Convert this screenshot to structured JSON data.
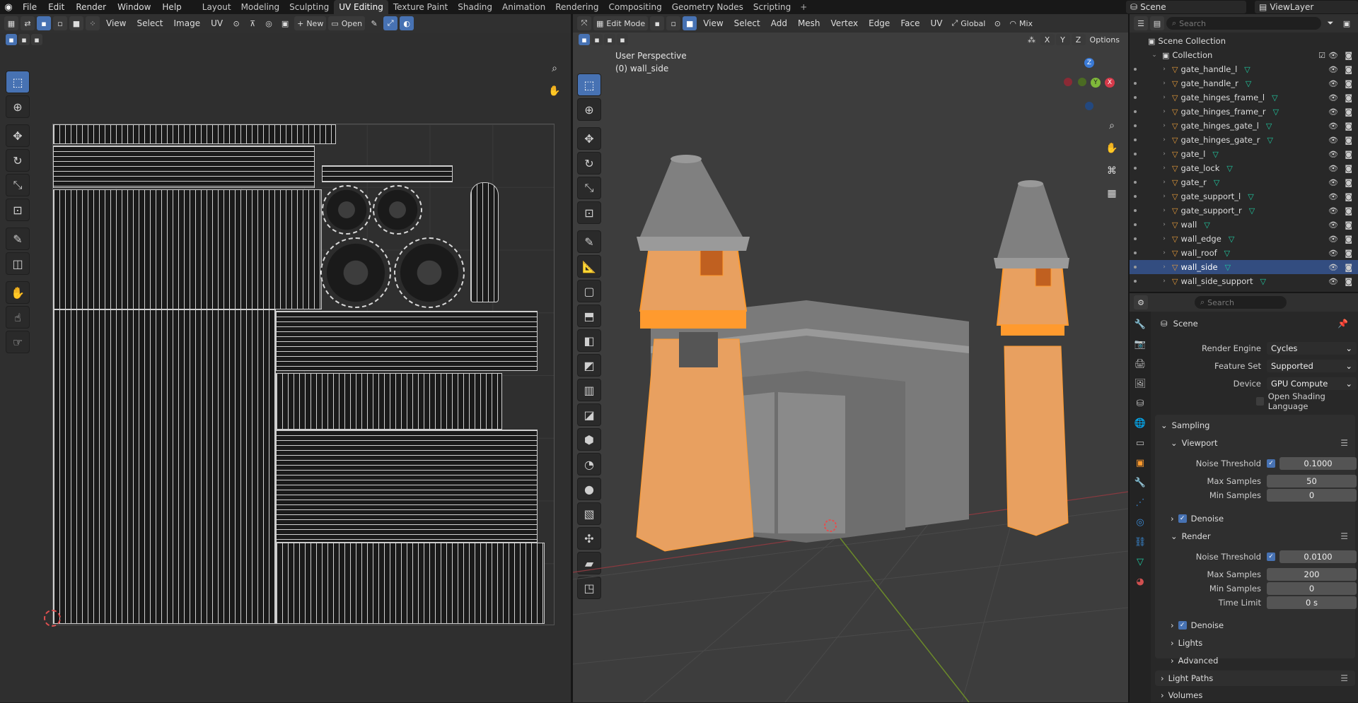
{
  "topbar": {
    "menus": [
      "File",
      "Edit",
      "Render",
      "Window",
      "Help"
    ],
    "workspaces": [
      "Layout",
      "Modeling",
      "Sculpting",
      "UV Editing",
      "Texture Paint",
      "Shading",
      "Animation",
      "Rendering",
      "Compositing",
      "Geometry Nodes",
      "Scripting"
    ],
    "active_workspace": "UV Editing",
    "scene": "Scene",
    "view_layer": "ViewLayer",
    "add_tab": "+"
  },
  "uv_editor": {
    "menus": [
      "View",
      "Select",
      "Image",
      "UV"
    ],
    "new_label": "New",
    "open_label": "Open",
    "new_icon": "+"
  },
  "viewport": {
    "mode": "Edit Mode",
    "menus": [
      "View",
      "Select",
      "Add",
      "Mesh",
      "Vertex",
      "Edge",
      "Face",
      "UV"
    ],
    "transform": "Global",
    "shading": "Mix",
    "options": "Options",
    "perspective": "User Perspective",
    "object_info": "(0) wall_side",
    "axes": {
      "x": "X",
      "y": "Y",
      "z": "Z"
    },
    "xyz": [
      "X",
      "Y",
      "Z"
    ]
  },
  "outliner": {
    "search_placeholder": "Search",
    "scene_collection": "Scene Collection",
    "collection": "Collection",
    "items": [
      "gate_handle_l",
      "gate_handle_r",
      "gate_hinges_frame_l",
      "gate_hinges_frame_r",
      "gate_hinges_gate_l",
      "gate_hinges_gate_r",
      "gate_l",
      "gate_lock",
      "gate_r",
      "gate_support_l",
      "gate_support_r",
      "wall",
      "wall_edge",
      "wall_roof",
      "wall_side",
      "wall_side_support"
    ],
    "selected": "wall_side"
  },
  "properties": {
    "search_placeholder": "Search",
    "context": "Scene",
    "render_engine_label": "Render Engine",
    "render_engine": "Cycles",
    "feature_set_label": "Feature Set",
    "feature_set": "Supported",
    "device_label": "Device",
    "device": "GPU Compute",
    "osl_label": "Open Shading Language",
    "sampling": "Sampling",
    "viewport": "Viewport",
    "noise_threshold_label": "Noise Threshold",
    "vp_noise": "0.1000",
    "max_samples_label": "Max Samples",
    "vp_max": "50",
    "min_samples_label": "Min Samples",
    "vp_min": "0",
    "denoise": "Denoise",
    "render": "Render",
    "r_noise": "0.0100",
    "r_max": "200",
    "r_min": "0",
    "time_limit_label": "Time Limit",
    "r_time": "0 s",
    "lights": "Lights",
    "advanced": "Advanced",
    "light_paths": "Light Paths",
    "volumes": "Volumes"
  },
  "colors": {
    "accent": "#4772b3",
    "selection": "#ff9a2e",
    "mesh_orange": "#e8a060",
    "axis_x": "#d63a4a",
    "axis_y": "#7fb83a",
    "axis_z": "#3a7ad6"
  }
}
